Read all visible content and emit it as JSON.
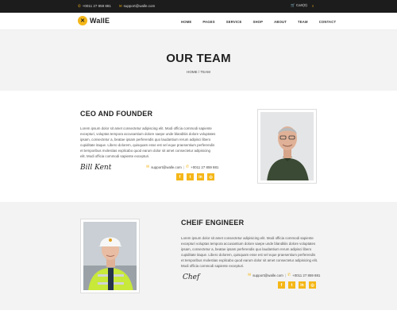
{
  "topbar": {
    "phone": "+0011 27 859 881",
    "email": "support@walle.com",
    "cart": "Cart(0)"
  },
  "brand": {
    "name": "WallE"
  },
  "nav": [
    "HOME",
    "PAGES",
    "SERVICE",
    "SHOP",
    "ABOUT",
    "TEAM",
    "CONTACT"
  ],
  "banner": {
    "title": "OUR TEAM",
    "breadcrumb": "HOME / TEAM"
  },
  "members": [
    {
      "role": "CEO AND FOUNDER",
      "bio": "Lorem ipsum dolor sit amet consectetur adipiscing elit. Modi officia commodi sapiente excepturi, voluptas tempora accusantium dolore saepe unde blanditiis dolore voluptates ipsam, consectetur a, beatae ipsam perferendis quo laudantium rerum adipisci libero cupiditate itaque. Libero dolorem, quisquam esse est vel eque praesentium perferendis et temporibus molestias explicabo quod earum dolor sit amet consectetur adipisicing elit. Modi officia commodi sapiente excepturi.",
      "signature": "Bill Kent",
      "email": "support@walle.com",
      "phone": "+0011 27 859 881"
    },
    {
      "role": "CHEIF ENGINEER",
      "bio": "Lorem ipsum dolor sit amet consectetur adipisicing elit. Modi officia commodi sapiente excepturi voluptas tempora accusantium dolore saepe unde blanditiis dolore voluptates ipsam, consectetur a, beatae ipsam perferendis quo laudantium rerum adipisci libero cupiditate itaque. Libero dolorem, quisquam esse est vel eque praesentium perferendis et temporibus molestias explicabo quod earum dolor sit amet consectetur adipisicing elit. Modi officia commodi sapiente excepturi.",
      "signature": "Chef",
      "email": "support@walle.com",
      "phone": "+0011 27 859 881"
    }
  ],
  "social": [
    {
      "glyph": "f",
      "icon": "facebook-icon"
    },
    {
      "glyph": "t",
      "icon": "twitter-icon"
    },
    {
      "glyph": "in",
      "icon": "linkedin-icon"
    },
    {
      "glyph": "◎",
      "icon": "instagram-icon"
    }
  ],
  "colors": {
    "accent": "#f5b718",
    "topbar": "#1c1c1c",
    "band": "#f3f3f3"
  }
}
